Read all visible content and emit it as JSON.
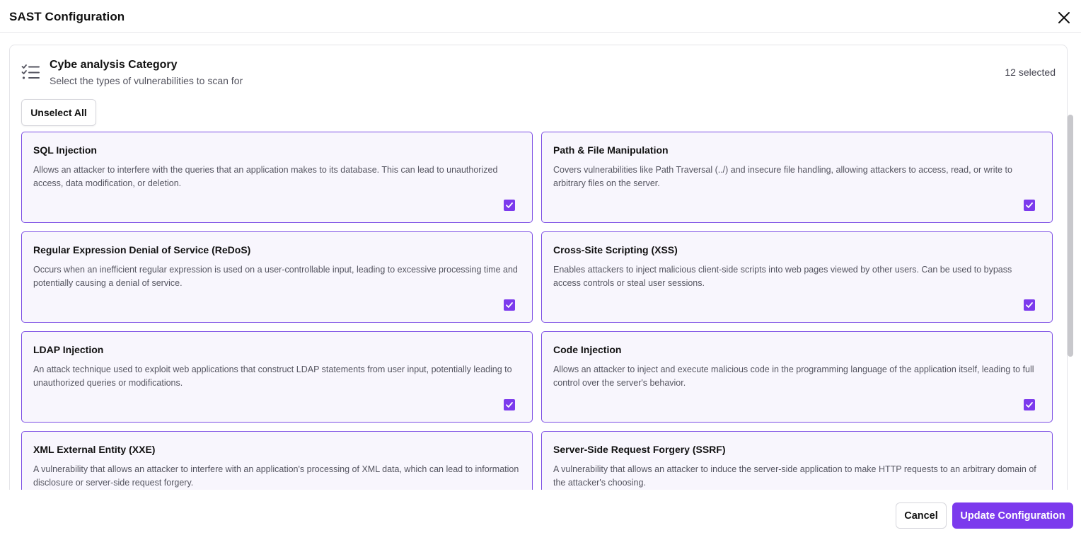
{
  "dialog": {
    "title": "SAST Configuration"
  },
  "section": {
    "title": "Cybe analysis Category",
    "subtitle": "Select the types of vulnerabilities to scan for",
    "selected_count": "12 selected",
    "unselect_all_label": "Unselect All"
  },
  "cards": [
    {
      "title": "SQL Injection",
      "description": "Allows an attacker to interfere with the queries that an application makes to its database. This can lead to unauthorized access, data modification, or deletion.",
      "checked": true
    },
    {
      "title": "Path & File Manipulation",
      "description": "Covers vulnerabilities like Path Traversal (../) and insecure file handling, allowing attackers to access, read, or write to arbitrary files on the server.",
      "checked": true
    },
    {
      "title": "Regular Expression Denial of Service (ReDoS)",
      "description": "Occurs when an inefficient regular expression is used on a user-controllable input, leading to excessive processing time and potentially causing a denial of service.",
      "checked": true
    },
    {
      "title": "Cross-Site Scripting (XSS)",
      "description": "Enables attackers to inject malicious client-side scripts into web pages viewed by other users. Can be used to bypass access controls or steal user sessions.",
      "checked": true
    },
    {
      "title": "LDAP Injection",
      "description": "An attack technique used to exploit web applications that construct LDAP statements from user input, potentially leading to unauthorized queries or modifications.",
      "checked": true
    },
    {
      "title": "Code Injection",
      "description": "Allows an attacker to inject and execute malicious code in the programming language of the application itself, leading to full control over the server's behavior.",
      "checked": true
    },
    {
      "title": "XML External Entity (XXE)",
      "description": "A vulnerability that allows an attacker to interfere with an application's processing of XML data, which can lead to information disclosure or server-side request forgery.",
      "checked": true
    },
    {
      "title": "Server-Side Request Forgery (SSRF)",
      "description": "A vulnerability that allows an attacker to induce the server-side application to make HTTP requests to an arbitrary domain of the attacker's choosing.",
      "checked": true
    }
  ],
  "footer": {
    "cancel_label": "Cancel",
    "update_label": "Update Configuration"
  },
  "colors": {
    "accent": "#7c3aed",
    "card_border": "#7c4ee4",
    "card_background": "#f8f6fd"
  },
  "icons": {
    "close": "close-icon",
    "section": "checklist-icon",
    "checkbox": "checkmark-icon"
  }
}
